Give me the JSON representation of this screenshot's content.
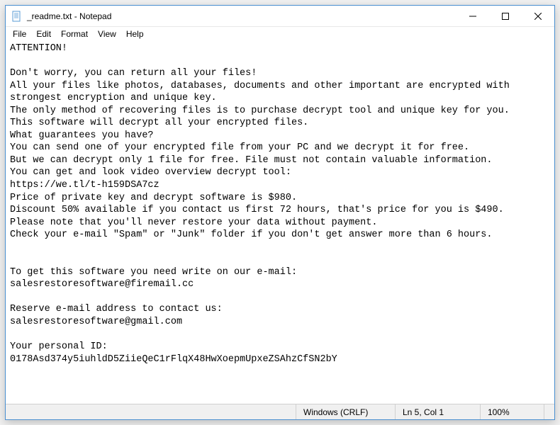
{
  "titlebar": {
    "title": "_readme.txt - Notepad"
  },
  "menubar": {
    "file": "File",
    "edit": "Edit",
    "format": "Format",
    "view": "View",
    "help": "Help"
  },
  "content": {
    "text": "ATTENTION!\n\nDon't worry, you can return all your files!\nAll your files like photos, databases, documents and other important are encrypted with strongest encryption and unique key.\nThe only method of recovering files is to purchase decrypt tool and unique key for you.\nThis software will decrypt all your encrypted files.\nWhat guarantees you have?\nYou can send one of your encrypted file from your PC and we decrypt it for free.\nBut we can decrypt only 1 file for free. File must not contain valuable information.\nYou can get and look video overview decrypt tool:\nhttps://we.tl/t-h159DSA7cz\nPrice of private key and decrypt software is $980.\nDiscount 50% available if you contact us first 72 hours, that's price for you is $490.\nPlease note that you'll never restore your data without payment.\nCheck your e-mail \"Spam\" or \"Junk\" folder if you don't get answer more than 6 hours.\n\n\nTo get this software you need write on our e-mail:\nsalesrestoresoftware@firemail.cc\n\nReserve e-mail address to contact us:\nsalesrestoresoftware@gmail.com\n\nYour personal ID:\n0178Asd374y5iuhldD5ZiieQeC1rFlqX48HwXoepmUpxeZSAhzCfSN2bY"
  },
  "statusbar": {
    "encoding": "Windows (CRLF)",
    "position": "Ln 5, Col 1",
    "zoom": "100%"
  }
}
